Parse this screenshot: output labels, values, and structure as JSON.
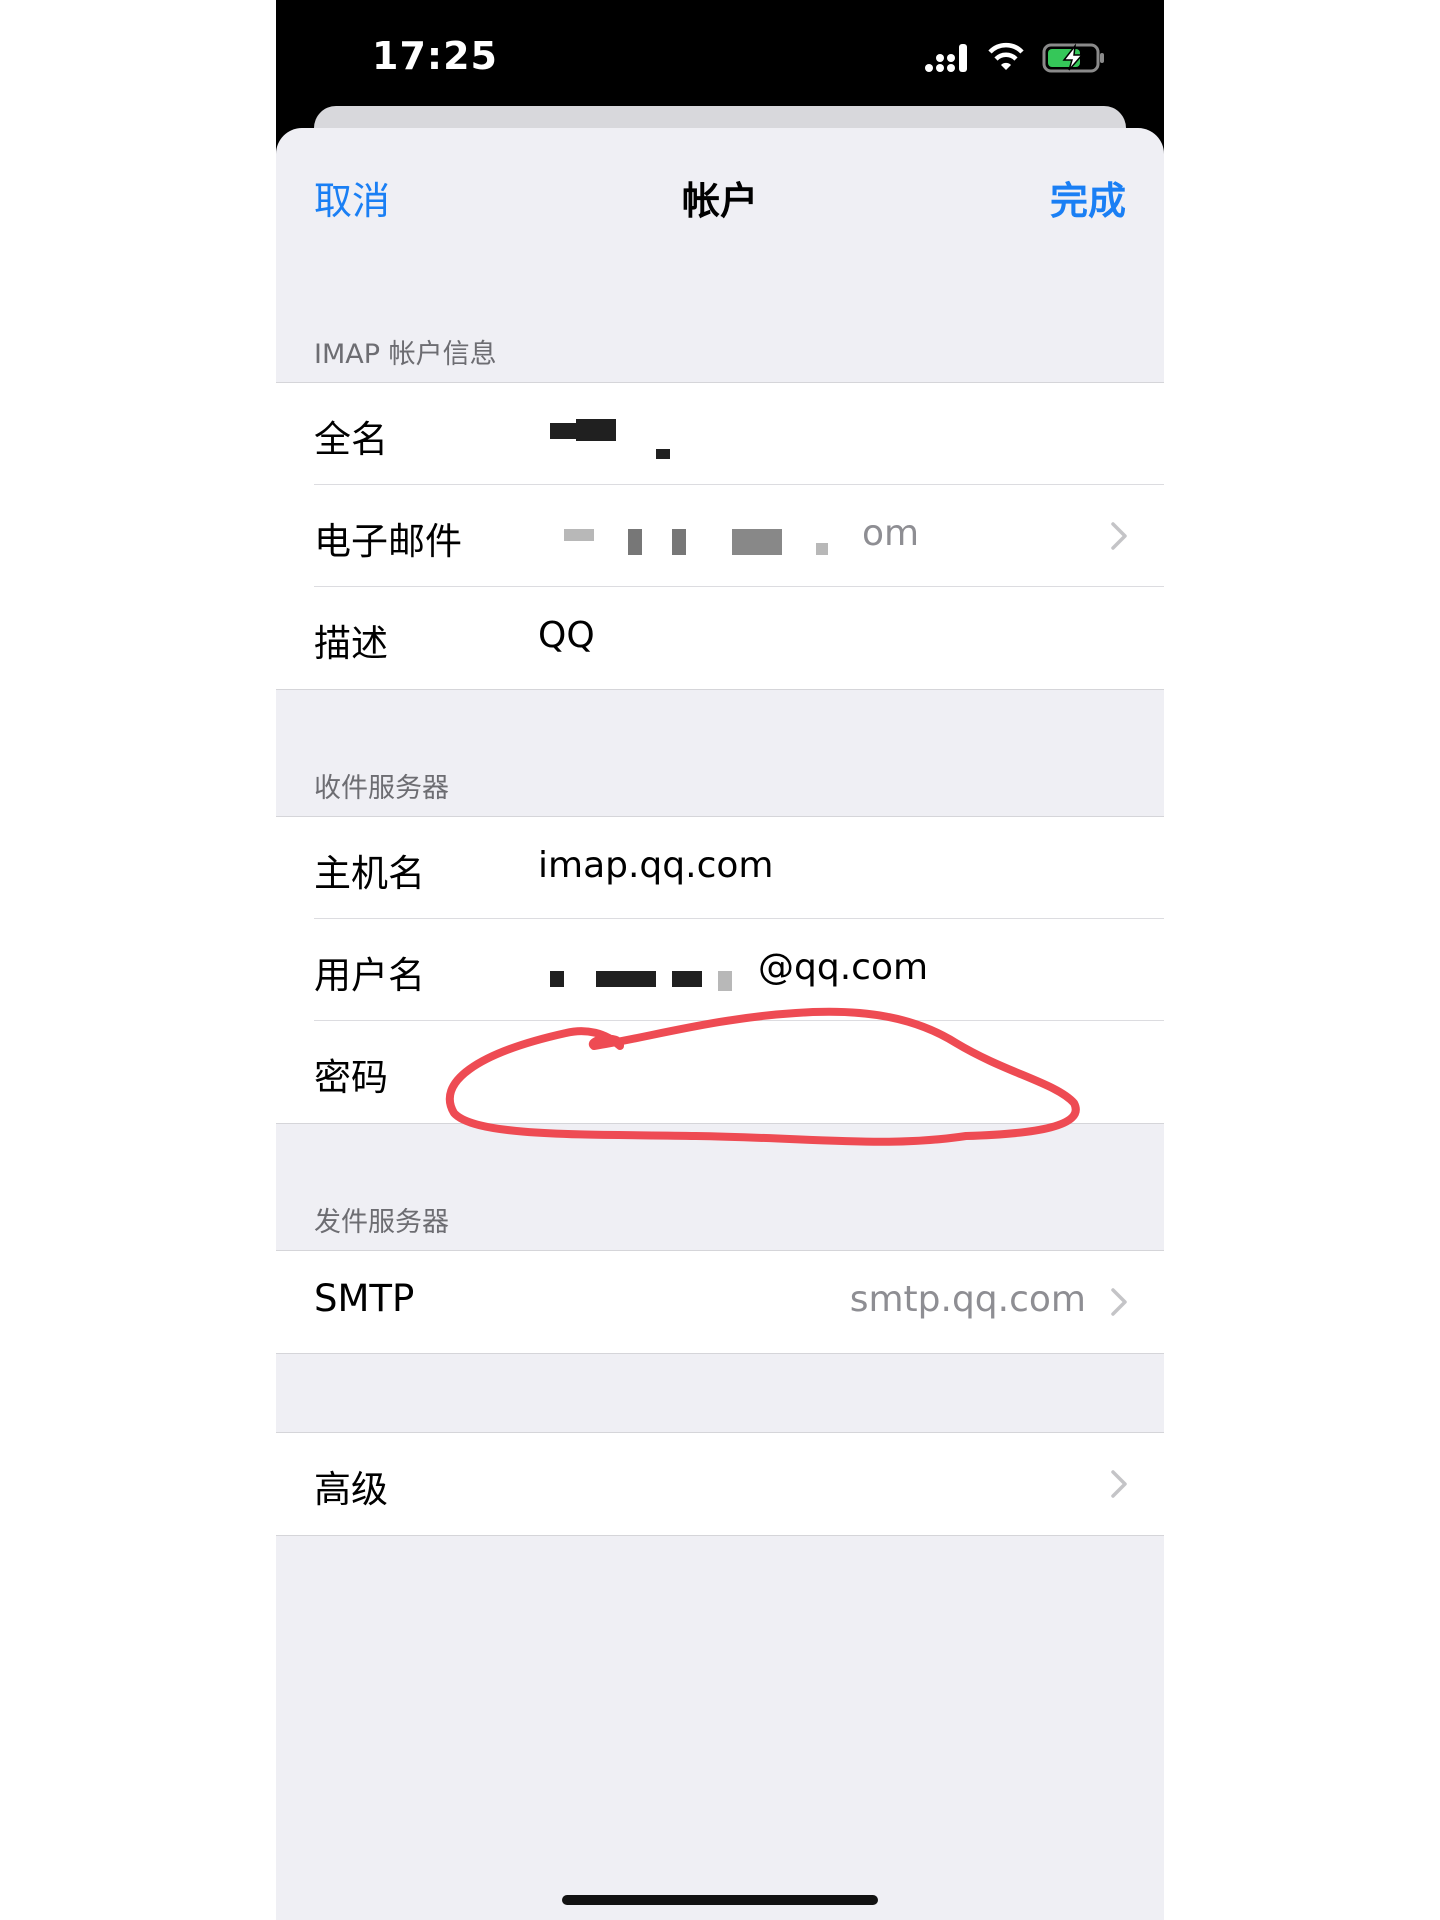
{
  "status_bar": {
    "time": "17:25"
  },
  "nav": {
    "cancel": "取消",
    "title": "帐户",
    "done": "完成"
  },
  "imap_section": {
    "header": "IMAP 帐户信息",
    "rows": [
      {
        "label": "全名",
        "value": ""
      },
      {
        "label": "电子邮件",
        "value": "om"
      },
      {
        "label": "描述",
        "value": "QQ"
      }
    ]
  },
  "incoming_section": {
    "header": "收件服务器",
    "rows": [
      {
        "label": "主机名",
        "value": "imap.qq.com"
      },
      {
        "label": "用户名",
        "value": "@qq.com"
      },
      {
        "label": "密码",
        "value": ""
      }
    ]
  },
  "outgoing_section": {
    "header": "发件服务器",
    "rows": [
      {
        "label": "SMTP",
        "value": "smtp.qq.com"
      }
    ]
  },
  "advanced": {
    "label": "高级"
  },
  "colors": {
    "accent": "#1a7ff4",
    "annotation": "#ee4b53"
  },
  "icons": [
    "signal-icon",
    "wifi-icon",
    "battery-charging-icon",
    "chevron-right-icon"
  ]
}
